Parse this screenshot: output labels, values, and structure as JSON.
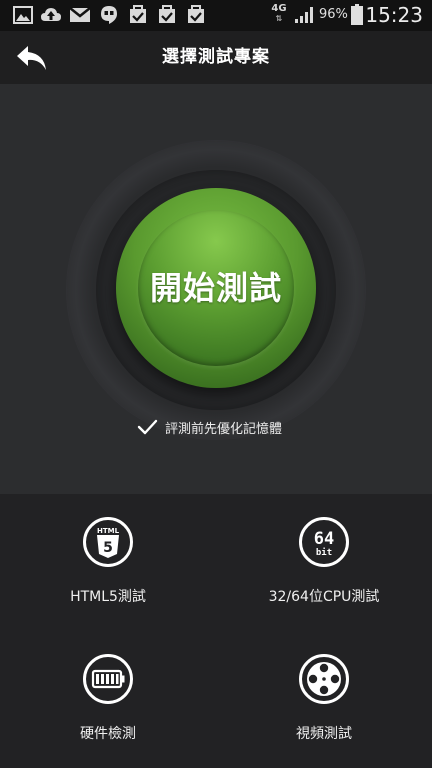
{
  "status_bar": {
    "network_type": "4G",
    "network_arrows": "⇅",
    "battery_percent": "96%",
    "time": "15:23",
    "notification_icons": [
      "gallery-icon",
      "cloud-upload-icon",
      "gmail-icon",
      "hangouts-icon",
      "task-check-icon",
      "task-check-icon",
      "task-check-icon"
    ]
  },
  "app_bar": {
    "title": "選擇測試專案",
    "back_icon": "back-arrow-icon"
  },
  "hero": {
    "start_button_label": "開始測試",
    "optimize_checked": true,
    "optimize_label": "評測前先優化記憶體"
  },
  "tests": [
    {
      "label": "HTML5測試",
      "icon": "html5-icon",
      "icon_text_top": "HTML",
      "icon_text_main": "5"
    },
    {
      "label": "32/64位CPU測試",
      "icon": "64bit-icon",
      "icon_text_top": "64",
      "icon_text_main": "bit"
    },
    {
      "label": "硬件檢測",
      "icon": "battery-hardware-icon"
    },
    {
      "label": "視頻測試",
      "icon": "film-reel-icon"
    }
  ],
  "colors": {
    "accent_green": "#5a9a2f",
    "background": "#2c2d2f",
    "app_bar": "#1f1f20",
    "status_bar": "#121212"
  }
}
